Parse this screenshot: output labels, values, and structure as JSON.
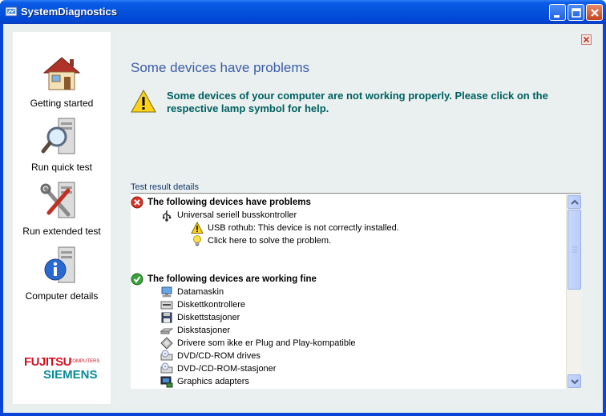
{
  "window": {
    "title": "SystemDiagnostics"
  },
  "sidebar": {
    "items": [
      {
        "label": "Getting started",
        "icon": "house-icon"
      },
      {
        "label": "Run quick test",
        "icon": "magnifier-computer-icon"
      },
      {
        "label": "Run extended test",
        "icon": "tools-computer-icon"
      },
      {
        "label": "Computer details",
        "icon": "info-computer-icon"
      }
    ],
    "logo": {
      "line1": "FUJITSU",
      "line2": "COMPUTERS",
      "line3": "SIEMENS"
    }
  },
  "main": {
    "heading": "Some devices have problems",
    "warning": "Some devices of your computer are not working properly. Please click on the respective lamp symbol for help.",
    "section_label": "Test result details",
    "problems": {
      "header": "The following devices have problems",
      "device": "Universal seriell busskontroller",
      "issue": "USB rothub: This device is not correctly installed.",
      "solve": "Click here to solve the problem."
    },
    "working": {
      "header": "The following devices are working fine",
      "devices": [
        "Datamaskin",
        "Diskettkontrollere",
        "Diskettstasjoner",
        "Diskstasjoner",
        "Drivere som ikke er Plug and Play-kompatible",
        "DVD/CD-ROM drives",
        "DVD-/CD-ROM-stasjoner",
        "Graphics adapters"
      ]
    }
  },
  "colors": {
    "accent": "#3d5ca6",
    "warning_text": "#006060",
    "titlebar": "#0453db"
  }
}
